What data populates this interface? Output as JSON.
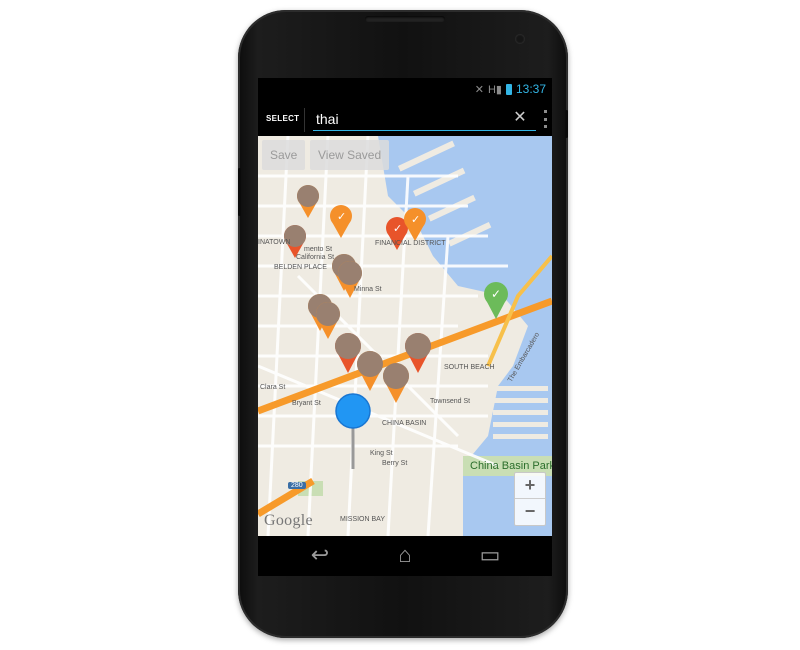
{
  "status": {
    "time": "13:37",
    "icons": [
      "mute-icon",
      "signal-icon",
      "battery-icon"
    ],
    "signal_label": "H"
  },
  "search": {
    "select_label": "SELECT",
    "query": "thai",
    "close_icon": "close-icon",
    "overflow_icon": "overflow-menu-icon"
  },
  "map": {
    "buttons": {
      "save": "Save",
      "view_saved": "View Saved"
    },
    "zoom": {
      "in": "+",
      "out": "−"
    },
    "logo": "Google",
    "labels": {
      "financial_district": "FINANCIAL DISTRICT",
      "belden_place": "BELDEN PLACE",
      "south_beach": "SOUTH BEACH",
      "china_basin": "CHINA BASIN",
      "china_basin_park": "China Basin Park",
      "mission_bay": "MISSION BAY",
      "bryant_st": "Bryant St",
      "townsend_st": "Townsend St",
      "king_st": "King St",
      "berry_st": "Berry St",
      "clara_st": "Clara St",
      "minna_st": "Minna St",
      "sacramento_st": "mento St",
      "california_st": "California St",
      "the_embarcadero": "The Embarcadero",
      "chinatown": "INATOWN",
      "hwy_280": "280"
    },
    "colors": {
      "water": "#a8c8f0",
      "land": "#efebe2",
      "freeway": "#f79a2a",
      "marker_orange": "#f5902a",
      "marker_red": "#e8542a",
      "marker_green": "#6cbb5a",
      "user_blue": "#2196f3"
    }
  },
  "nav": {
    "back_icon": "back-icon",
    "home_icon": "home-icon",
    "recents_icon": "recents-icon"
  }
}
